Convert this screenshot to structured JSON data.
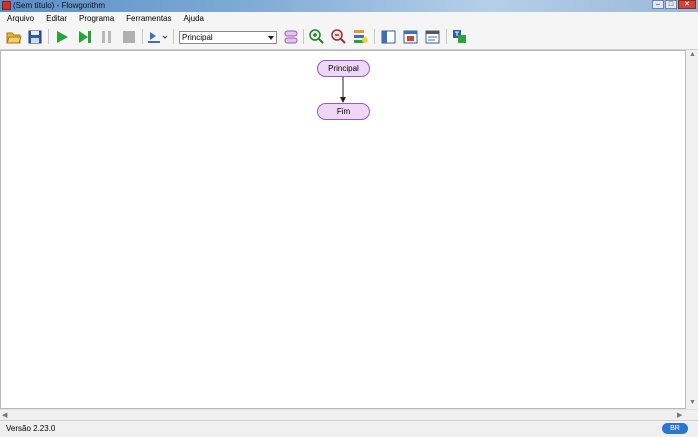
{
  "window": {
    "title": "(Sem título) - Flowgorithm"
  },
  "menu": [
    "Arquivo",
    "Editar",
    "Programa",
    "Ferramentas",
    "Ajuda"
  ],
  "toolbar": {
    "function_select": "Principal"
  },
  "flowchart": {
    "start_label": "Principal",
    "end_label": "Fim"
  },
  "status": {
    "version": "Versão 2.23.0",
    "language": "BR"
  }
}
